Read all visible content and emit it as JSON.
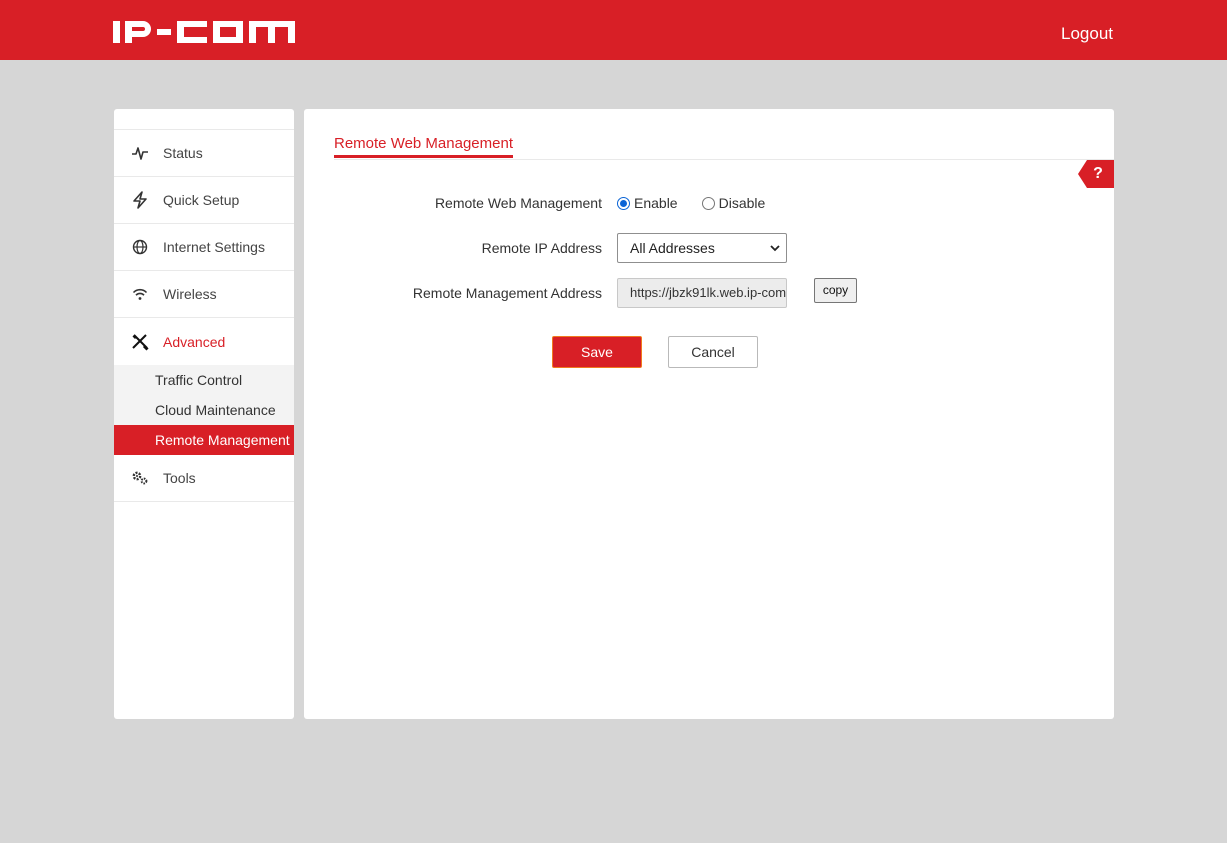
{
  "header": {
    "logo_text": "IP-COM",
    "logout_label": "Logout",
    "brand_color": "#d81f26"
  },
  "sidebar": {
    "items": [
      {
        "label": "Status",
        "icon": "pulse-icon"
      },
      {
        "label": "Quick Setup",
        "icon": "lightning-icon"
      },
      {
        "label": "Internet Settings",
        "icon": "globe-icon"
      },
      {
        "label": "Wireless",
        "icon": "wifi-icon"
      },
      {
        "label": "Advanced",
        "icon": "tools-cross-icon",
        "active": true,
        "children": [
          {
            "label": "Traffic Control"
          },
          {
            "label": "Cloud Maintenance"
          },
          {
            "label": "Remote Management",
            "selected": true
          }
        ]
      },
      {
        "label": "Tools",
        "icon": "gears-icon"
      }
    ]
  },
  "main": {
    "title": "Remote Web Management",
    "help_label": "?",
    "form": {
      "remote_web_management": {
        "label": "Remote Web Management",
        "options": [
          "Enable",
          "Disable"
        ],
        "selected": "Enable"
      },
      "remote_ip_address": {
        "label": "Remote IP Address",
        "value": "All Addresses"
      },
      "remote_management_address": {
        "label": "Remote Management Address",
        "value": "https://jbzk91lk.web.ip-com",
        "copy_label": "copy"
      }
    },
    "save_label": "Save",
    "cancel_label": "Cancel"
  }
}
